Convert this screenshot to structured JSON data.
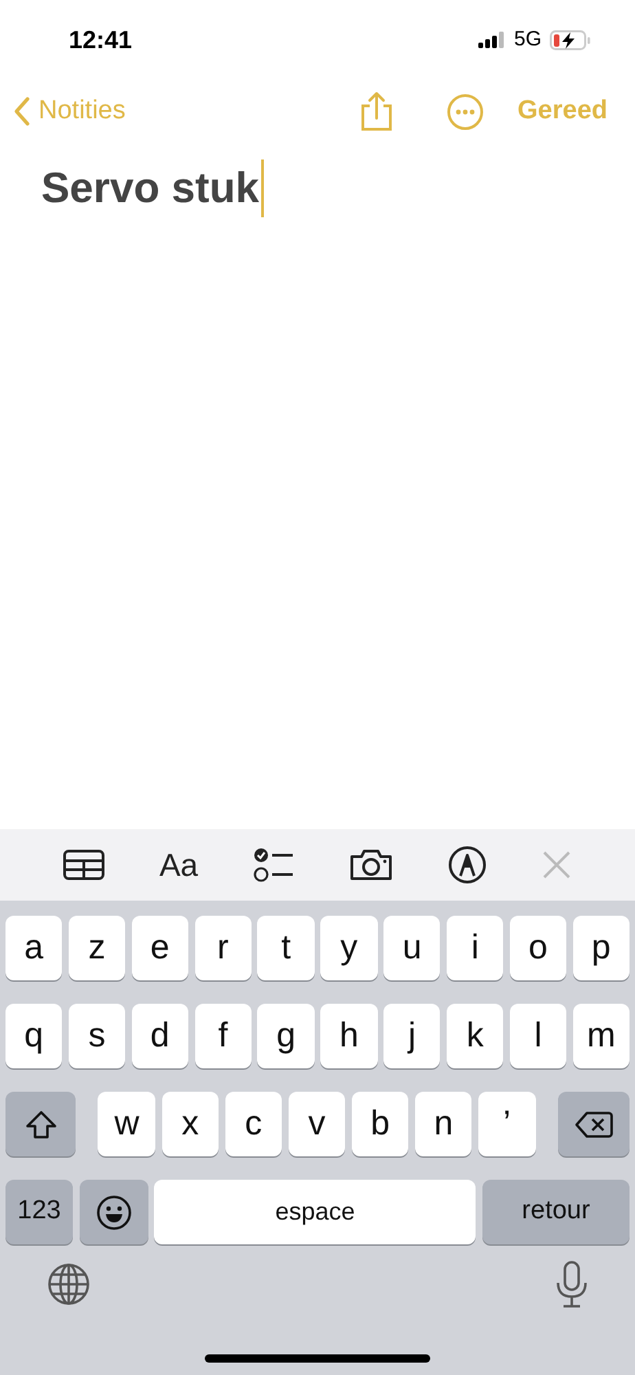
{
  "status_bar": {
    "time": "12:41",
    "network": "5G"
  },
  "nav": {
    "back_label": "Notities",
    "done_label": "Gereed"
  },
  "note": {
    "title": "Servo stuk",
    "cursor": true
  },
  "toolbar": [
    {
      "kind": "table"
    },
    {
      "kind": "text",
      "label": "Aa"
    },
    {
      "kind": "checklist"
    },
    {
      "kind": "camera"
    },
    {
      "kind": "markup"
    },
    {
      "kind": "close"
    }
  ],
  "keyboard": {
    "rows": [
      {
        "keys": [
          {
            "kind": "letter",
            "label": "a"
          },
          {
            "kind": "letter",
            "label": "z"
          },
          {
            "kind": "letter",
            "label": "e"
          },
          {
            "kind": "letter",
            "label": "r"
          },
          {
            "kind": "letter",
            "label": "t"
          },
          {
            "kind": "letter",
            "label": "y"
          },
          {
            "kind": "letter",
            "label": "u"
          },
          {
            "kind": "letter",
            "label": "i"
          },
          {
            "kind": "letter",
            "label": "o"
          },
          {
            "kind": "letter",
            "label": "p"
          }
        ]
      },
      {
        "keys": [
          {
            "kind": "letter",
            "label": "q"
          },
          {
            "kind": "letter",
            "label": "s"
          },
          {
            "kind": "letter",
            "label": "d"
          },
          {
            "kind": "letter",
            "label": "f"
          },
          {
            "kind": "letter",
            "label": "g"
          },
          {
            "kind": "letter",
            "label": "h"
          },
          {
            "kind": "letter",
            "label": "j"
          },
          {
            "kind": "letter",
            "label": "k"
          },
          {
            "kind": "letter",
            "label": "l"
          },
          {
            "kind": "letter",
            "label": "m"
          }
        ]
      },
      {
        "keys": [
          {
            "kind": "shift"
          },
          {
            "kind": "letter",
            "label": "w"
          },
          {
            "kind": "letter",
            "label": "x"
          },
          {
            "kind": "letter",
            "label": "c"
          },
          {
            "kind": "letter",
            "label": "v"
          },
          {
            "kind": "letter",
            "label": "b"
          },
          {
            "kind": "letter",
            "label": "n"
          },
          {
            "kind": "letter",
            "label": "’"
          },
          {
            "kind": "backspace"
          }
        ]
      },
      {
        "keys": [
          {
            "kind": "numbers",
            "label": "123"
          },
          {
            "kind": "emoji"
          },
          {
            "kind": "space",
            "label": "espace"
          },
          {
            "kind": "return",
            "label": "retour"
          }
        ]
      }
    ]
  }
}
